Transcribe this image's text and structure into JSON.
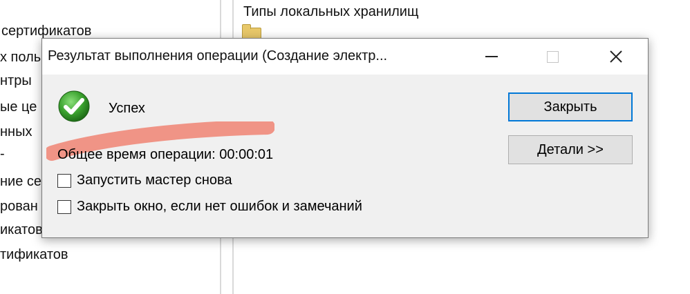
{
  "background": {
    "tree_items": [
      "сертификатов",
      "х поль",
      "нтры",
      "ые це",
      "нных",
      "-",
      "ние се",
      "рован",
      "икатов",
      "тификатов"
    ],
    "list_items": [
      "Типы локальных хранилищ"
    ]
  },
  "dialog": {
    "title": "Результат выполнения операции (Создание электр...",
    "status_label": "Успех",
    "elapsed_text": "Общее время операции: 00:00:01",
    "checkboxes": [
      {
        "label": "Запустить мастер снова",
        "checked": false
      },
      {
        "label": "Закрыть окно, если нет ошибок и замечаний",
        "checked": false
      }
    ],
    "buttons": {
      "close_label": "Закрыть",
      "details_label": "Детали >>"
    }
  },
  "colors": {
    "success_green": "#3aa12e",
    "annotation_red": "#f08a7a",
    "default_button_border": "#0078d7"
  },
  "icons": {
    "success": "green-checkmark-circle",
    "minimize": "minimize-icon",
    "maximize": "maximize-icon",
    "close": "close-icon"
  }
}
